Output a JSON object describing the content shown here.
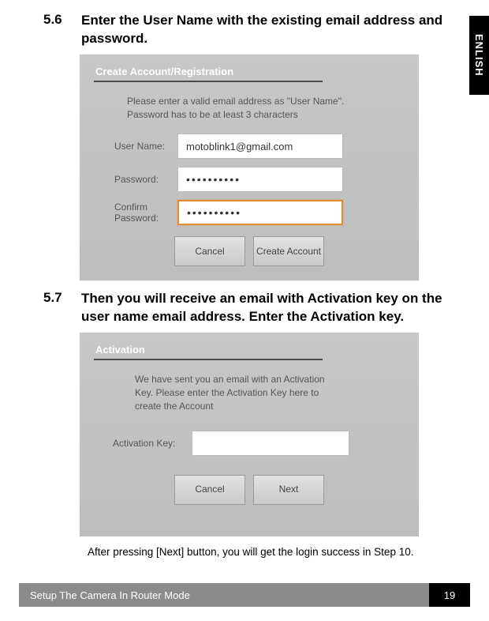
{
  "language_tab": "ENLISH",
  "steps": {
    "s56": {
      "num": "5.6",
      "text": "Enter the User Name with the existing email address and password."
    },
    "s57": {
      "num": "5.7",
      "text": "Then you will receive an email with Activation key on the user name email address.  Enter the Activation key."
    }
  },
  "figure1": {
    "title": "Create Account/Registration",
    "help": "Please enter a valid email address as \"User Name\". Password has to be at least 3 characters",
    "labels": {
      "username": "User Name:",
      "password": "Password:",
      "confirm": "Confirm Password:"
    },
    "values": {
      "username": "motoblink1@gmail.com",
      "password": "••••••••••",
      "confirm": "••••••••••"
    },
    "buttons": {
      "cancel": "Cancel",
      "create": "Create Account"
    }
  },
  "figure2": {
    "title": "Activation",
    "help": "We have sent you an email with  an Activation Key.  Please enter the Activation Key here to create the Account",
    "labels": {
      "key": "Activation Key:"
    },
    "values": {
      "key": ""
    },
    "buttons": {
      "cancel": "Cancel",
      "next": "Next"
    }
  },
  "note": "After pressing [Next] button, you will get the login success in Step 10.",
  "footer": {
    "section": "Setup The Camera In Router Mode",
    "page": "19"
  }
}
